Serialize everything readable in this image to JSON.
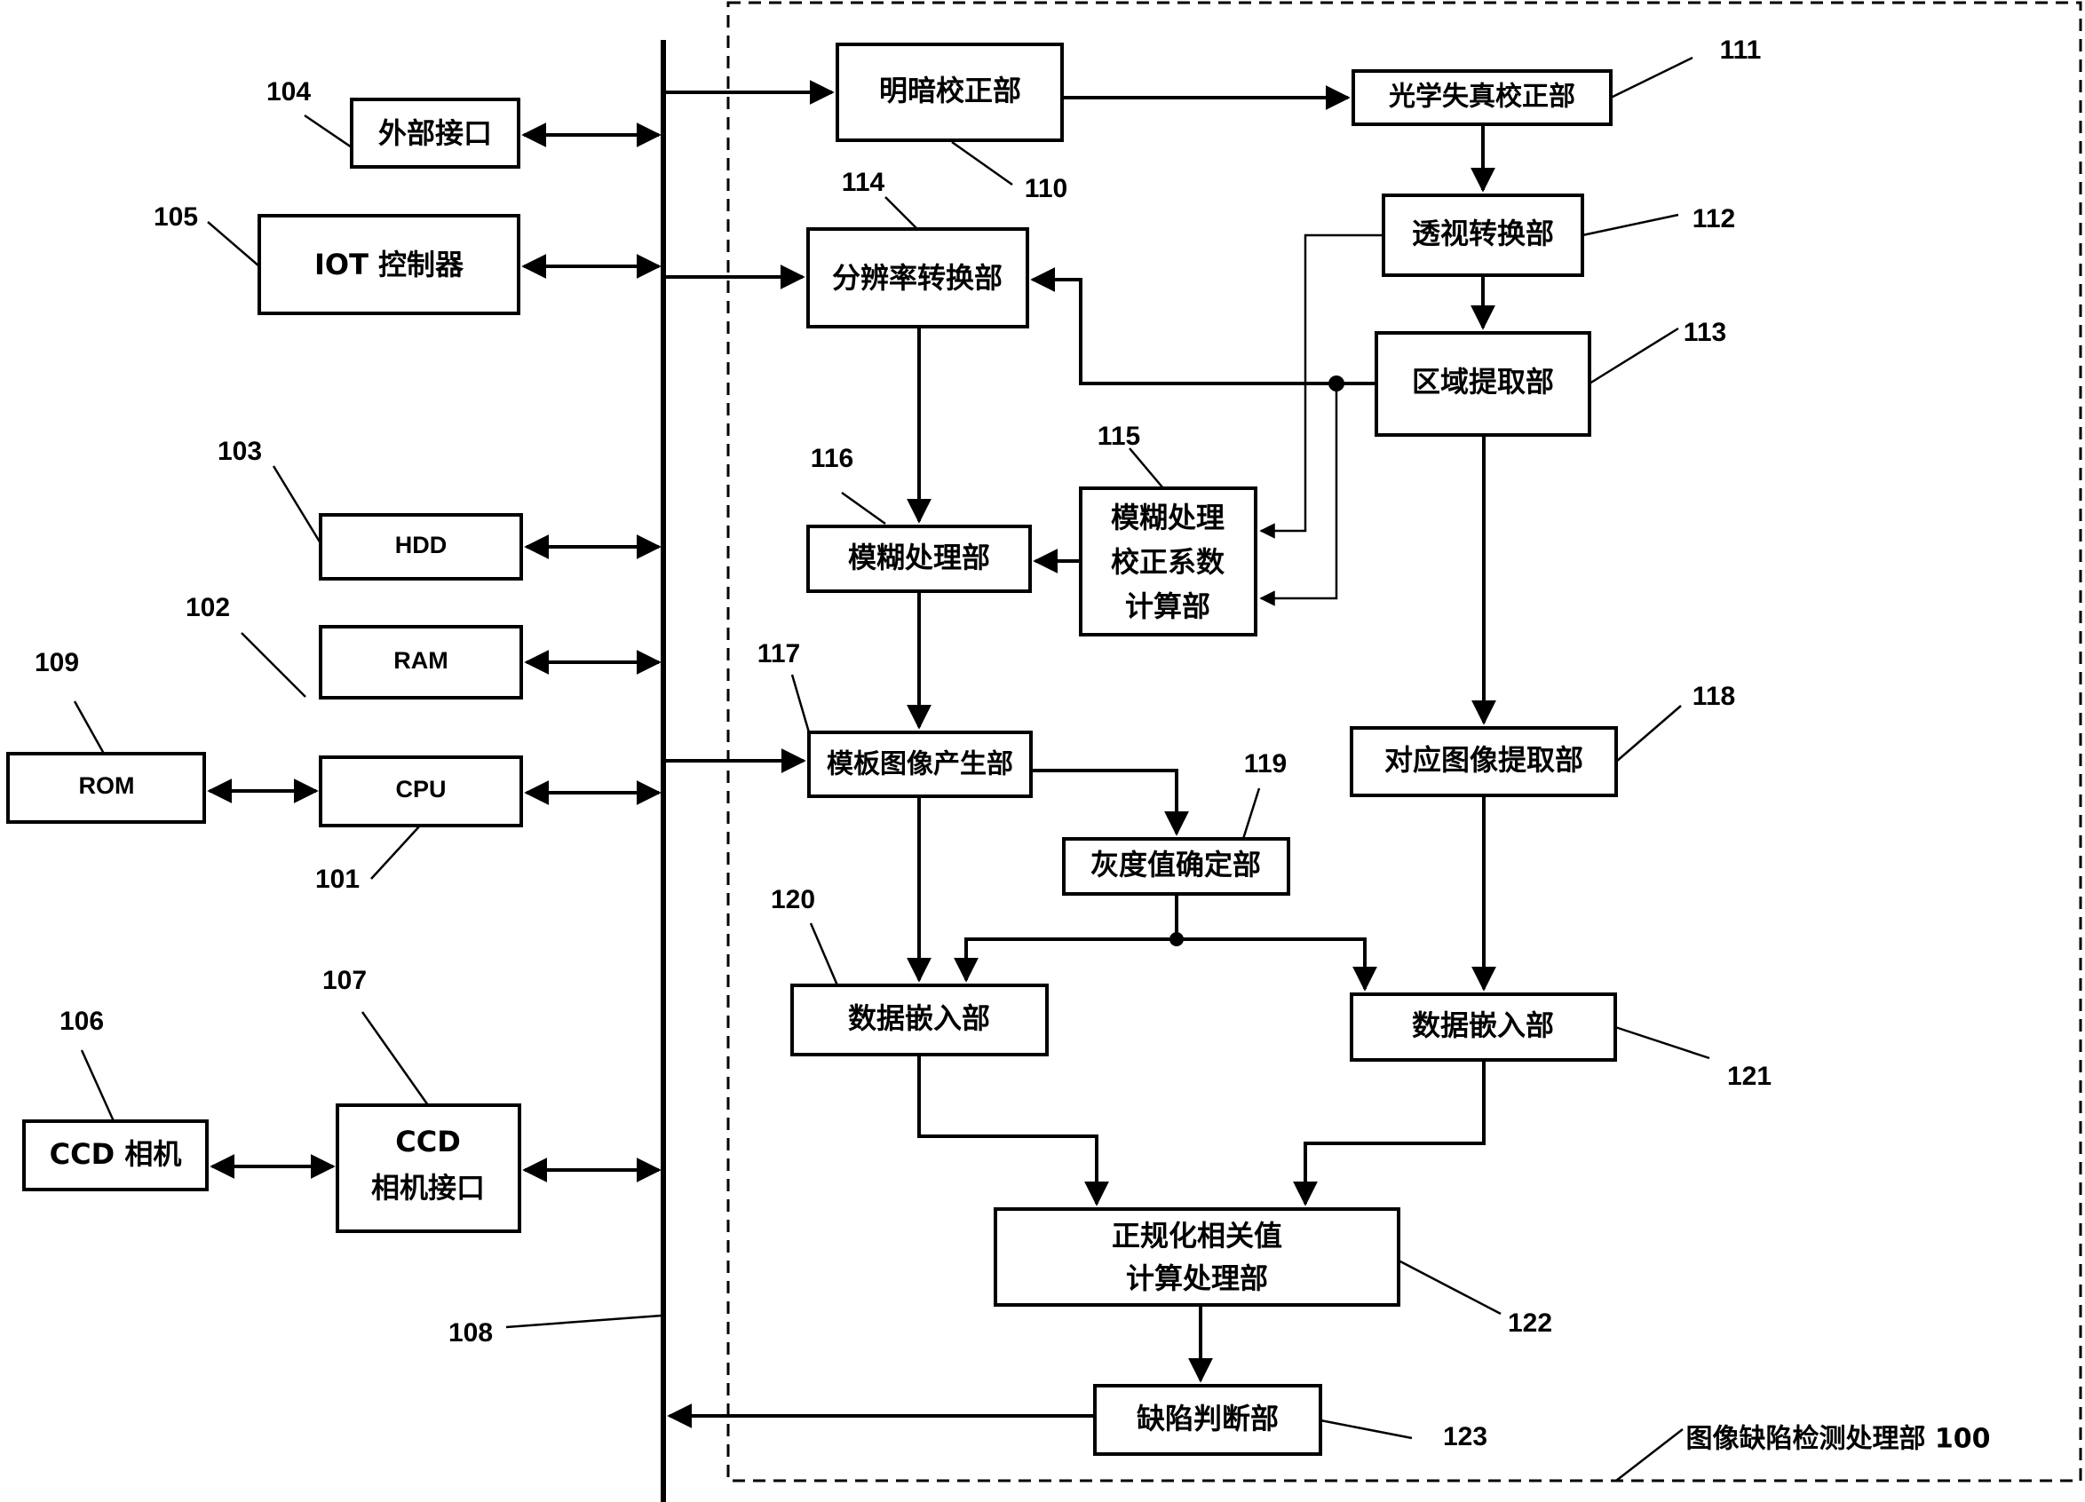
{
  "diagram": {
    "frame_label": "图像缺陷检测处理部 100",
    "bus_label": "108",
    "left_blocks": [
      {
        "id": "104",
        "label": "外部接口"
      },
      {
        "id": "105",
        "label": "IOT 控制器"
      },
      {
        "id": "103",
        "label": "HDD"
      },
      {
        "id": "102",
        "label": "RAM"
      },
      {
        "id": "109",
        "label": "ROM"
      },
      {
        "id": "101",
        "label": "CPU"
      },
      {
        "id": "106",
        "label": "CCD 相机"
      },
      {
        "id": "107",
        "label_line1": "CCD",
        "label_line2": "相机接口"
      }
    ],
    "blocks": [
      {
        "id": "110",
        "label": "明暗校正部"
      },
      {
        "id": "111",
        "label": "光学失真校正部"
      },
      {
        "id": "112",
        "label": "透视转换部"
      },
      {
        "id": "113",
        "label": "区域提取部"
      },
      {
        "id": "114",
        "label": "分辨率转换部"
      },
      {
        "id": "115",
        "label_line1": "模糊处理",
        "label_line2": "校正系数",
        "label_line3": "计算部"
      },
      {
        "id": "116",
        "label": "模糊处理部"
      },
      {
        "id": "117",
        "label": "模板图像产生部"
      },
      {
        "id": "118",
        "label": "对应图像提取部"
      },
      {
        "id": "119",
        "label": "灰度值确定部"
      },
      {
        "id": "120",
        "label": "数据嵌入部"
      },
      {
        "id": "121",
        "label": "数据嵌入部"
      },
      {
        "id": "122",
        "label_line1": "正规化相关值",
        "label_line2": "计算处理部"
      },
      {
        "id": "123",
        "label": "缺陷判断部"
      }
    ]
  }
}
